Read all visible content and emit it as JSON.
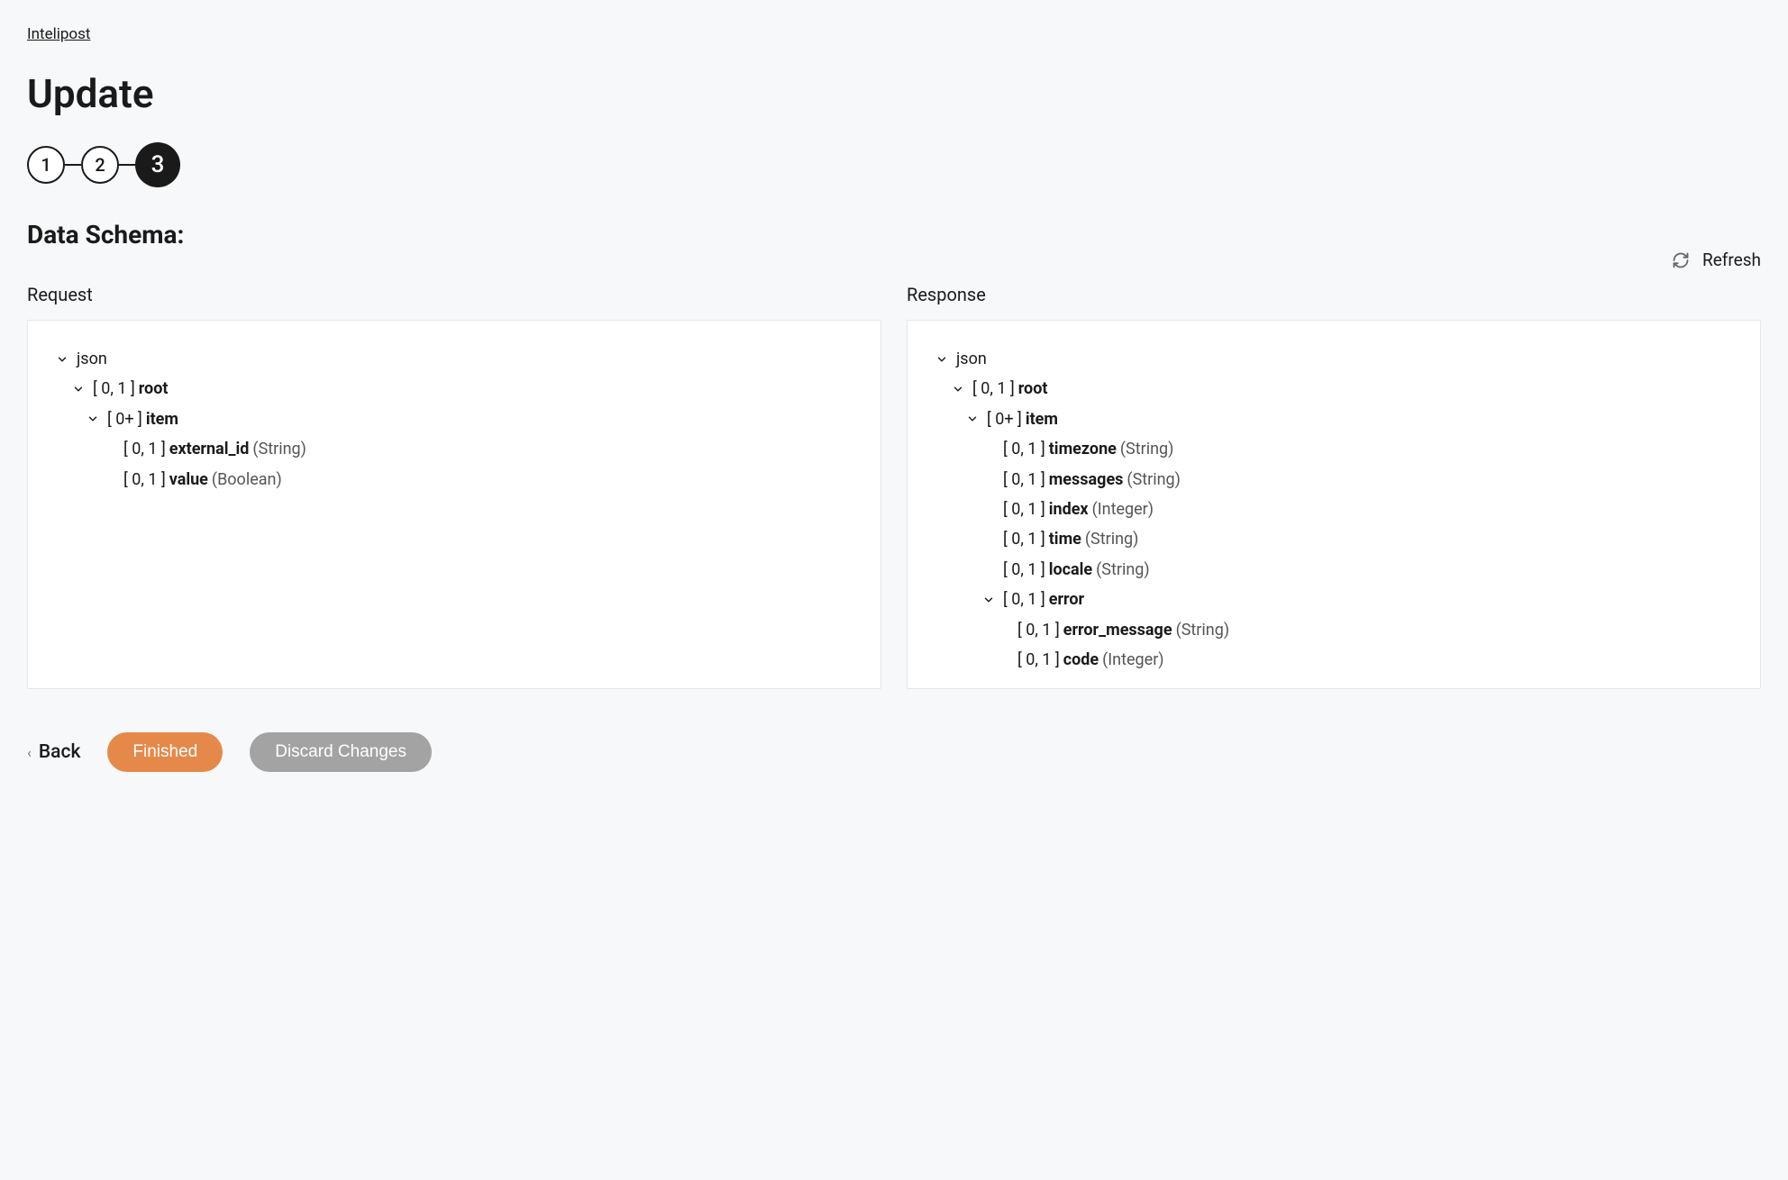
{
  "breadcrumb": {
    "label": "Intelipost"
  },
  "page": {
    "title": "Update",
    "section_title": "Data Schema:"
  },
  "stepper": {
    "steps": [
      "1",
      "2",
      "3"
    ],
    "active_index": 2
  },
  "refresh": {
    "label": "Refresh"
  },
  "columns": {
    "request": {
      "label": "Request",
      "root_label": "json",
      "tree": [
        {
          "level": 1,
          "expandable": true,
          "cardinality": "[ 0, 1 ]",
          "name": "root",
          "type": ""
        },
        {
          "level": 2,
          "expandable": true,
          "cardinality": "[ 0+ ]",
          "name": "item",
          "type": ""
        },
        {
          "level": 3,
          "expandable": false,
          "cardinality": "[ 0, 1 ]",
          "name": "external_id",
          "type": "(String)"
        },
        {
          "level": 3,
          "expandable": false,
          "cardinality": "[ 0, 1 ]",
          "name": "value",
          "type": "(Boolean)"
        }
      ]
    },
    "response": {
      "label": "Response",
      "root_label": "json",
      "tree": [
        {
          "level": 1,
          "expandable": true,
          "cardinality": "[ 0, 1 ]",
          "name": "root",
          "type": ""
        },
        {
          "level": 2,
          "expandable": true,
          "cardinality": "[ 0+ ]",
          "name": "item",
          "type": ""
        },
        {
          "level": 3,
          "expandable": false,
          "cardinality": "[ 0, 1 ]",
          "name": "timezone",
          "type": "(String)"
        },
        {
          "level": 3,
          "expandable": false,
          "cardinality": "[ 0, 1 ]",
          "name": "messages",
          "type": "(String)"
        },
        {
          "level": 3,
          "expandable": false,
          "cardinality": "[ 0, 1 ]",
          "name": "index",
          "type": "(Integer)"
        },
        {
          "level": 3,
          "expandable": false,
          "cardinality": "[ 0, 1 ]",
          "name": "time",
          "type": "(String)"
        },
        {
          "level": 3,
          "expandable": false,
          "cardinality": "[ 0, 1 ]",
          "name": "locale",
          "type": "(String)"
        },
        {
          "level": 3,
          "expandable": true,
          "cardinality": "[ 0, 1 ]",
          "name": "error",
          "type": ""
        },
        {
          "level": 4,
          "expandable": false,
          "cardinality": "[ 0, 1 ]",
          "name": "error_message",
          "type": "(String)"
        },
        {
          "level": 4,
          "expandable": false,
          "cardinality": "[ 0, 1 ]",
          "name": "code: ",
          "name2": "code",
          "type": "(Integer)"
        }
      ]
    }
  },
  "footer": {
    "back": "Back",
    "finished": "Finished",
    "discard": "Discard Changes"
  }
}
